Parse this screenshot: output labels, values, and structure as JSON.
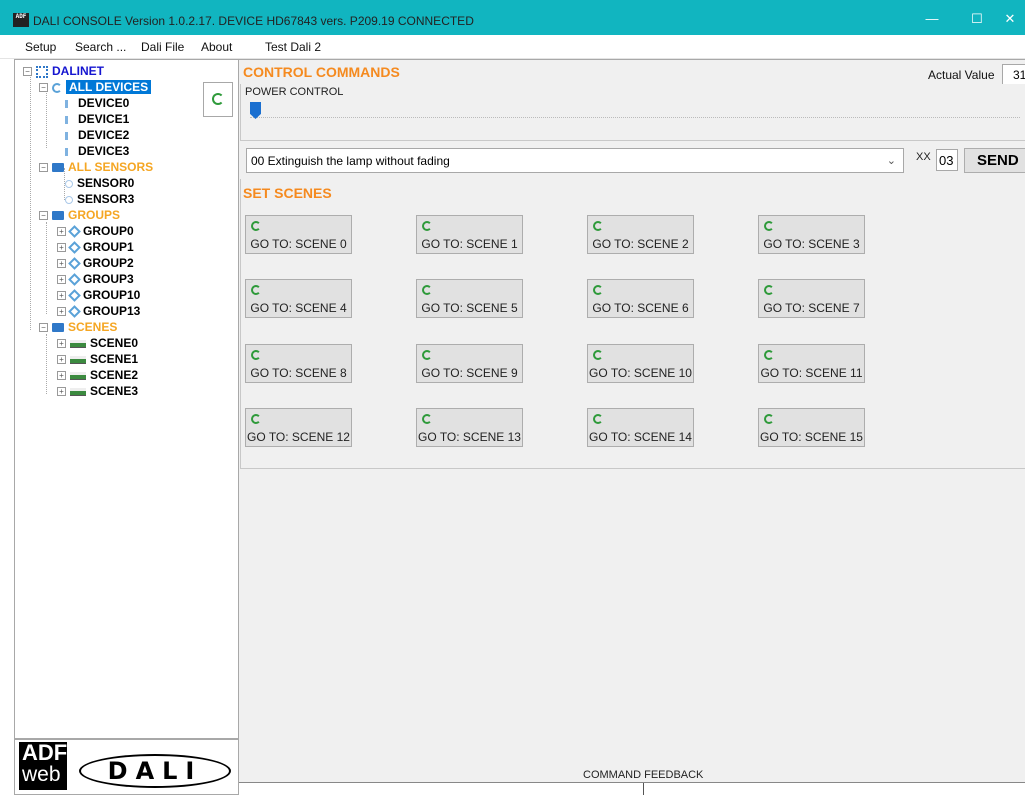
{
  "window": {
    "app_icon_text": "ADF web",
    "title": "DALI CONSOLE Version 1.0.2.17.  DEVICE HD67843    vers. P209.19 CONNECTED",
    "minimize": "—",
    "maximize": "☐",
    "close": "✕"
  },
  "menu": {
    "setup": "Setup",
    "search": "Search ...",
    "dali_file": "Dali File",
    "about": "About",
    "project": "Test Dali 2"
  },
  "tree": {
    "root": "DALINET",
    "all_devices": "ALL DEVICES",
    "devices": [
      "DEVICE0",
      "DEVICE1",
      "DEVICE2",
      "DEVICE3"
    ],
    "all_sensors": "ALL SENSORS",
    "sensors": [
      "SENSOR0",
      "SENSOR3"
    ],
    "groups_label": "GROUPS",
    "groups": [
      "GROUP0",
      "GROUP1",
      "GROUP2",
      "GROUP3",
      "GROUP10",
      "GROUP13"
    ],
    "scenes_label": "SCENES",
    "scenes": [
      "SCENE0",
      "SCENE1",
      "SCENE2",
      "SCENE3"
    ]
  },
  "logo": {
    "adf_line1": "ADF",
    "adf_line2": "web",
    "dali": "DALI"
  },
  "control": {
    "title": "CONTROL COMMANDS",
    "actual_value_label": "Actual Value",
    "actual_value": "31",
    "power_label": "POWER CONTROL",
    "power_level": 0,
    "command_selected": "00 Extinguish the lamp without fading",
    "xx_label": "XX",
    "xx_value": "03",
    "send_label": "SEND"
  },
  "scenes": {
    "title": "SET SCENES",
    "buttons": [
      "GO TO: SCENE 0",
      "GO TO: SCENE 1",
      "GO TO: SCENE 2",
      "GO TO: SCENE 3",
      "GO TO: SCENE 4",
      "GO TO: SCENE 5",
      "GO TO: SCENE 6",
      "GO TO: SCENE 7",
      "GO TO: SCENE 8",
      "GO TO: SCENE 9",
      "GO TO: SCENE 10",
      "GO TO: SCENE 11",
      "GO TO: SCENE 12",
      "GO TO: SCENE 13",
      "GO TO: SCENE 14",
      "GO TO: SCENE 15"
    ]
  },
  "feedback": {
    "label": "COMMAND FEEDBACK"
  },
  "colors": {
    "titlebar": "#11b5c0",
    "section_title": "#f58a1f",
    "tree_category": "#f5a623",
    "selection": "#0078d7"
  }
}
